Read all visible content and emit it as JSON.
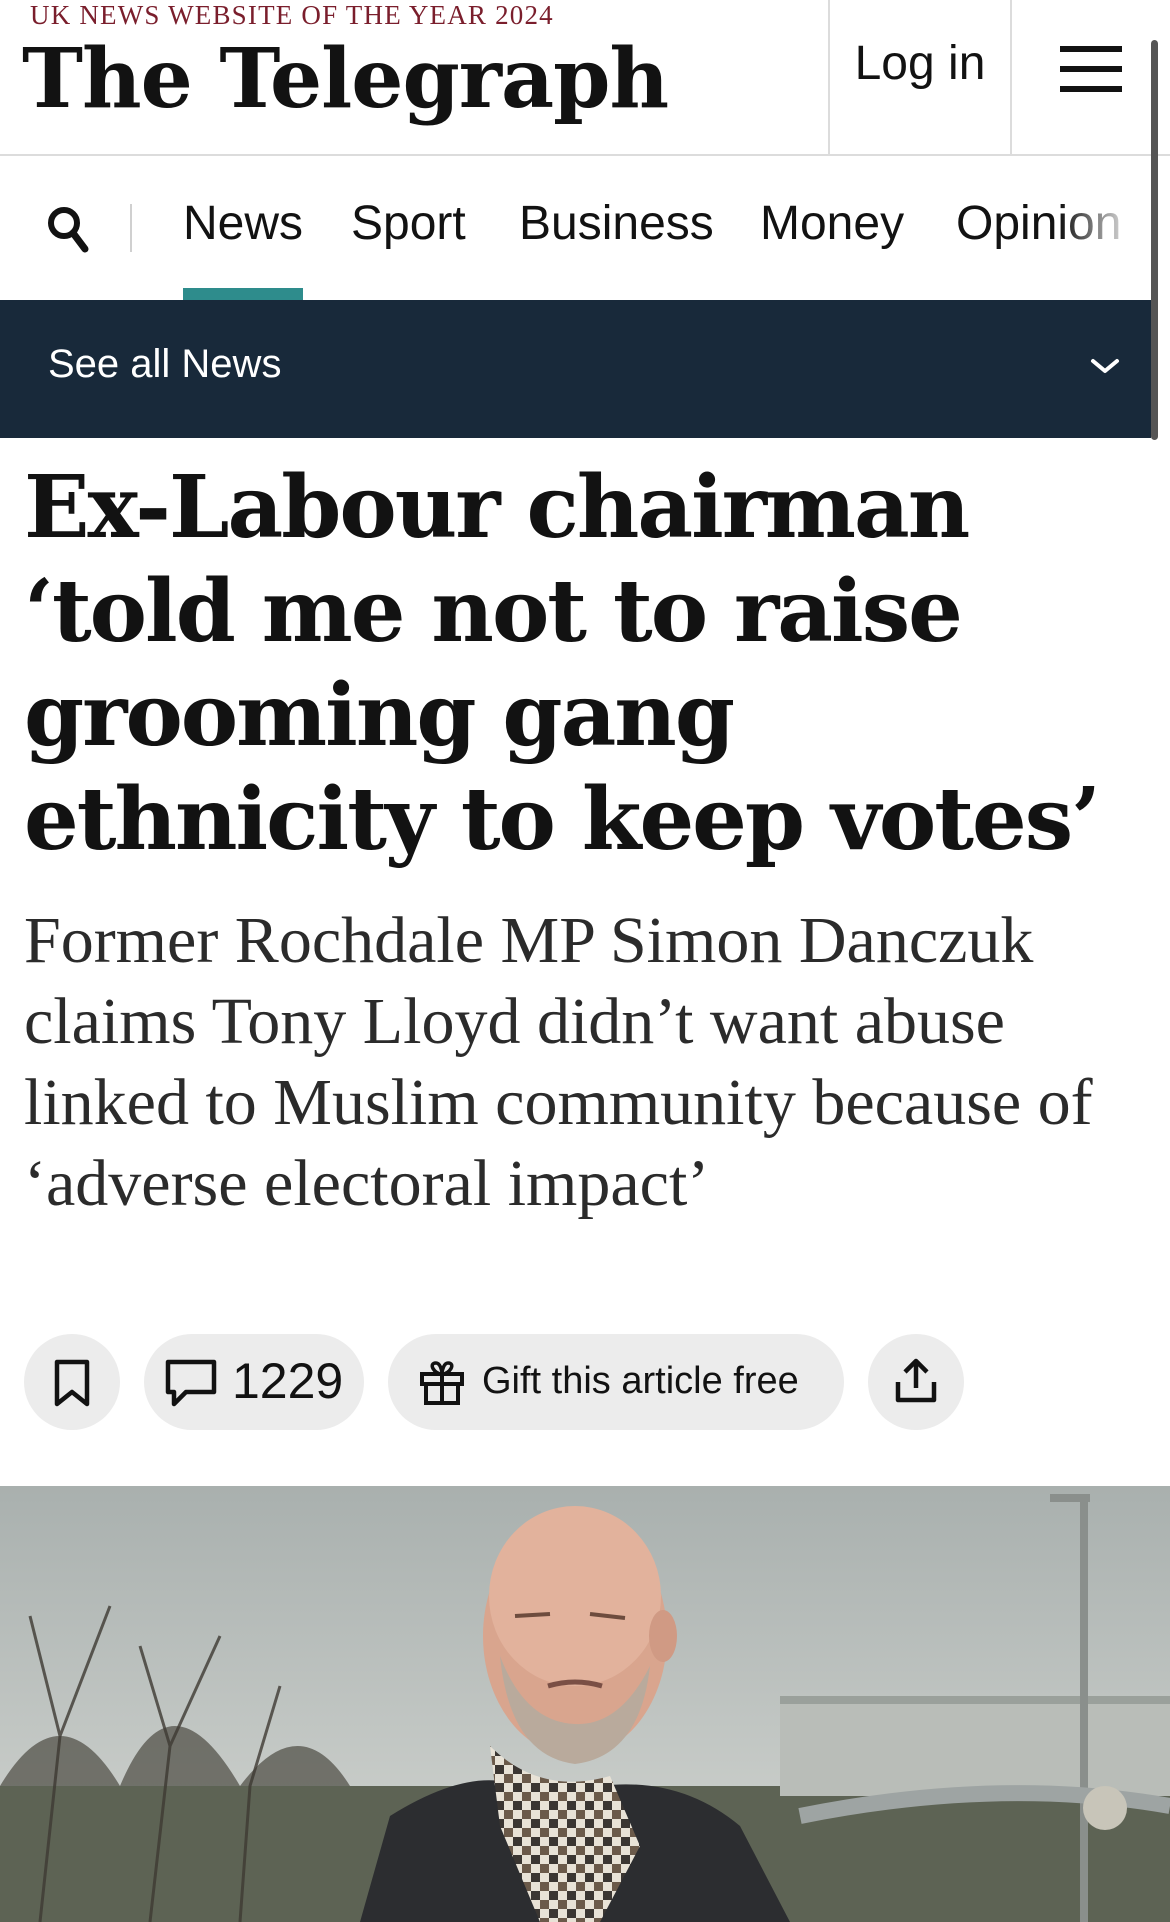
{
  "header": {
    "tagline": "UK NEWS WEBSITE OF THE YEAR 2024",
    "masthead": "The Telegraph",
    "login_label": "Log in",
    "menu_icon": "hamburger-menu-icon"
  },
  "nav": {
    "search_icon": "search-icon",
    "items": [
      {
        "label": "News",
        "active": true
      },
      {
        "label": "Sport"
      },
      {
        "label": "Business"
      },
      {
        "label": "Money"
      },
      {
        "label": "Opinion"
      }
    ],
    "active_color": "#2e8c8c"
  },
  "subnav": {
    "label": "See all News",
    "background": "#18293a"
  },
  "article": {
    "headline": "Ex-Labour chairman ‘told me not to raise grooming gang ethnicity to keep votes’",
    "standfirst": "Former Rochdale MP Simon Danczuk claims Tony Lloyd didn’t want abuse linked to Muslim community because of ‘adverse electoral impact’",
    "actions": {
      "bookmark_icon": "bookmark-icon",
      "comment_icon": "comment-icon",
      "comment_count": "1229",
      "gift_icon": "gift-icon",
      "gift_label": "Gift this article free",
      "share_icon": "share-icon"
    },
    "photo_alt": "man-in-scarf-photo"
  }
}
